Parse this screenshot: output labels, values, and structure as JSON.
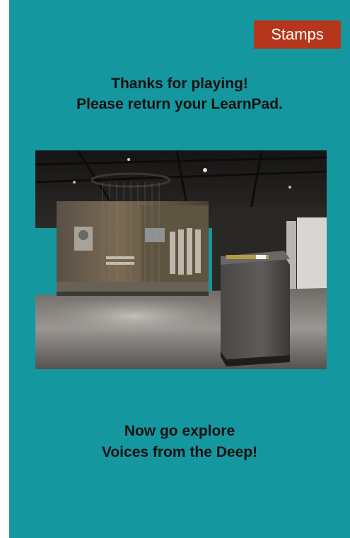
{
  "header": {
    "stamps_label": "Stamps"
  },
  "message": {
    "line1": "Thanks for playing!",
    "line2": "Please return your LearnPad."
  },
  "photo": {
    "description_icon": "exhibit-room-photo"
  },
  "footer": {
    "line1": "Now go explore",
    "line2": "Voices from the Deep!"
  },
  "colors": {
    "background": "#15979f",
    "button": "#b5361b",
    "text": "#111111"
  }
}
